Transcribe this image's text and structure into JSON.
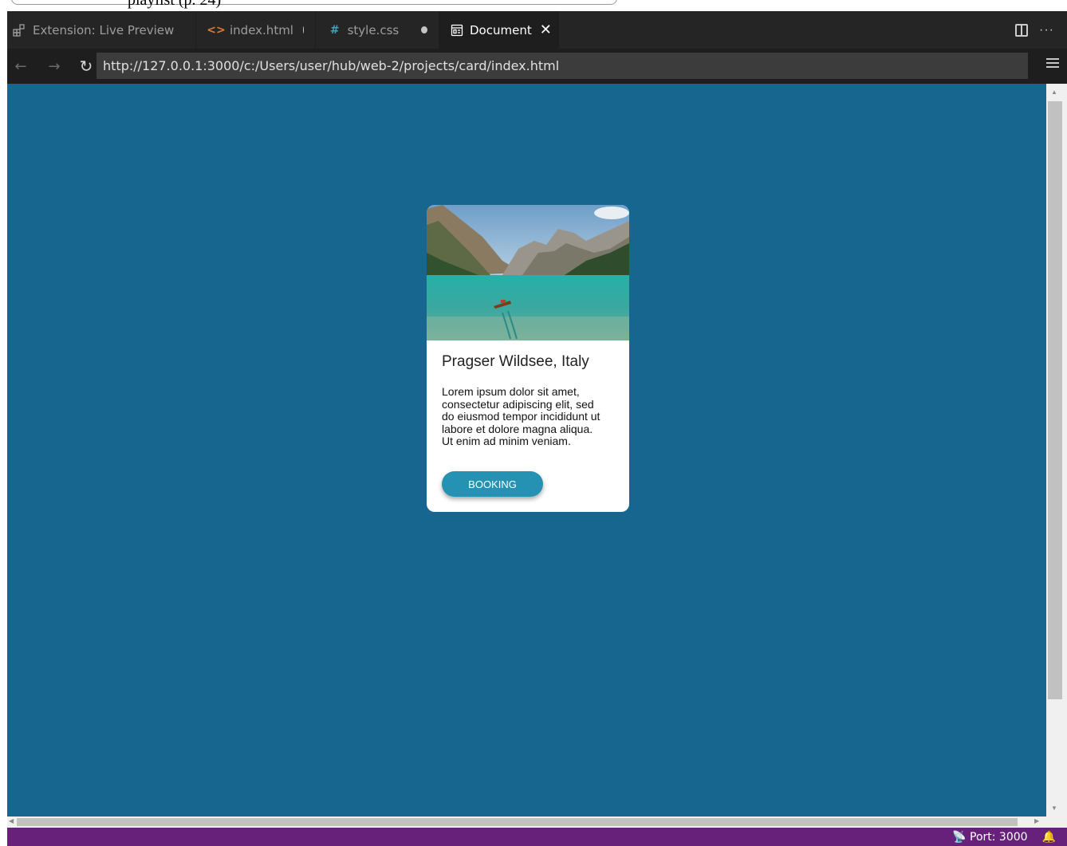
{
  "top_partial": {
    "text": "playlist (p. 24)"
  },
  "tabs": [
    {
      "label": "Extension: Live Preview",
      "icon": "extensions-icon",
      "modified": false,
      "active": false
    },
    {
      "label": "index.html",
      "icon": "html-file-icon",
      "modified": true,
      "active": false
    },
    {
      "label": "style.css",
      "icon": "css-file-icon",
      "modified": true,
      "active": false
    },
    {
      "label": "Document",
      "icon": "preview-icon",
      "modified": false,
      "active": true
    }
  ],
  "tab_actions": {
    "split": "split-editor-icon",
    "more": "···"
  },
  "navbar": {
    "back": "←",
    "forward": "→",
    "reload": "↻",
    "url": "http://127.0.0.1:3000/c:/Users/user/hub/web-2/projects/card/index.html"
  },
  "card": {
    "title": "Pragser Wildsee, Italy",
    "text": "Lorem ipsum dolor sit amet, consectetur adipiscing elit, sed do eiusmod tempor incididunt ut labore et dolore magna aliqua. Ut enim ad minim veniam.",
    "button_label": "BOOKING",
    "image": "mountain lake with boat"
  },
  "statusbar": {
    "port": "Port: 3000"
  },
  "colors": {
    "page_background": "#166690",
    "button": "#2692b3",
    "statusbar": "#68217a",
    "tabbar": "#252526"
  }
}
